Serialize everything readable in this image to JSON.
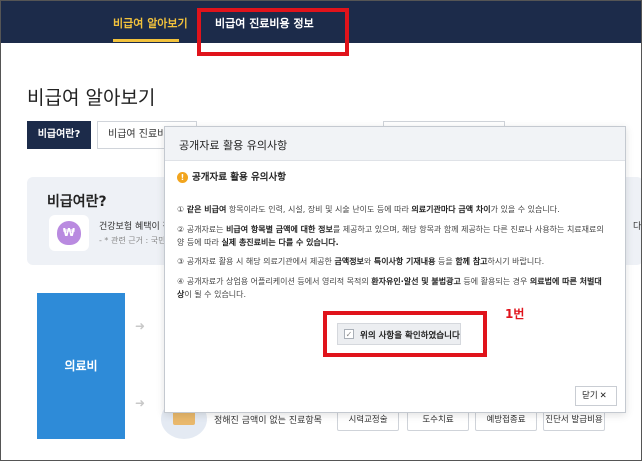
{
  "nav": {
    "tab_info": "비급여 알아보기",
    "tab_cost": "비급여 진료비용 정보"
  },
  "page": {
    "title": "비급여 알아보기",
    "pills": [
      "비급여란?",
      "비급여 진료비"
    ],
    "info_title": "비급여란?",
    "info_desc": "건강보험 혜택이 적",
    "info_note": "- * 관련 근거 : 국민건",
    "info_tail": "다",
    "wallet_symbol": "₩",
    "blue_block_label": "의료비",
    "bottom_label": "정해진 금액이 없는 진료항목",
    "chips": [
      "시력교정술",
      "도수치료",
      "예방접종료",
      "진단서 발급비용"
    ]
  },
  "modal": {
    "title": "공개자료 활용 유의사항",
    "notice_heading": "공개자료 활용 유의사항",
    "notice_icon": "!",
    "items": [
      {
        "num": "①",
        "p1": "같은 비급여",
        "p2": " 항목이라도 인력, 시설, 장비 및 시술 난이도 등에 따라 ",
        "p3": "의료기관마다 금액 차이",
        "p4": "가 있을 수 있습니다."
      },
      {
        "num": "②",
        "p1": "공개자료는 ",
        "p2": "비급여 항목별 금액에 대한 정보",
        "p3": "를 제공하고 있으며, 해당 항목과 함께 제공하는 다른 진료나 사용하는 치료재료의 양 등에 따라 ",
        "p4": "실제 총진료비는 다를 수 있습니다."
      },
      {
        "num": "③",
        "p1": "공개자료 활용 시 해당 의료기관에서 제공한 ",
        "p2": "금액정보",
        "p3": "와 ",
        "p4": "특이사항 기재내용",
        "p5": " 등을 ",
        "p6": "함께 참고",
        "p7": "하시기 바랍니다."
      },
      {
        "num": "④",
        "p1": "공개자료가 상업용 어플리케이션 등에서 영리적 목적의 ",
        "p2": "환자유인·알선 및 불법광고",
        "p3": " 등에 활용되는 경우 ",
        "p4": "의료법에 따른 처벌대상",
        "p5": "이 될 수 있습니다."
      }
    ],
    "confirm_label": "위의 사항을 확인하였습니다",
    "checkbox_mark": "✓",
    "close_label": "닫기",
    "close_icon": "✕"
  },
  "annotation": {
    "label": "1번",
    "color": "#e0131b"
  }
}
